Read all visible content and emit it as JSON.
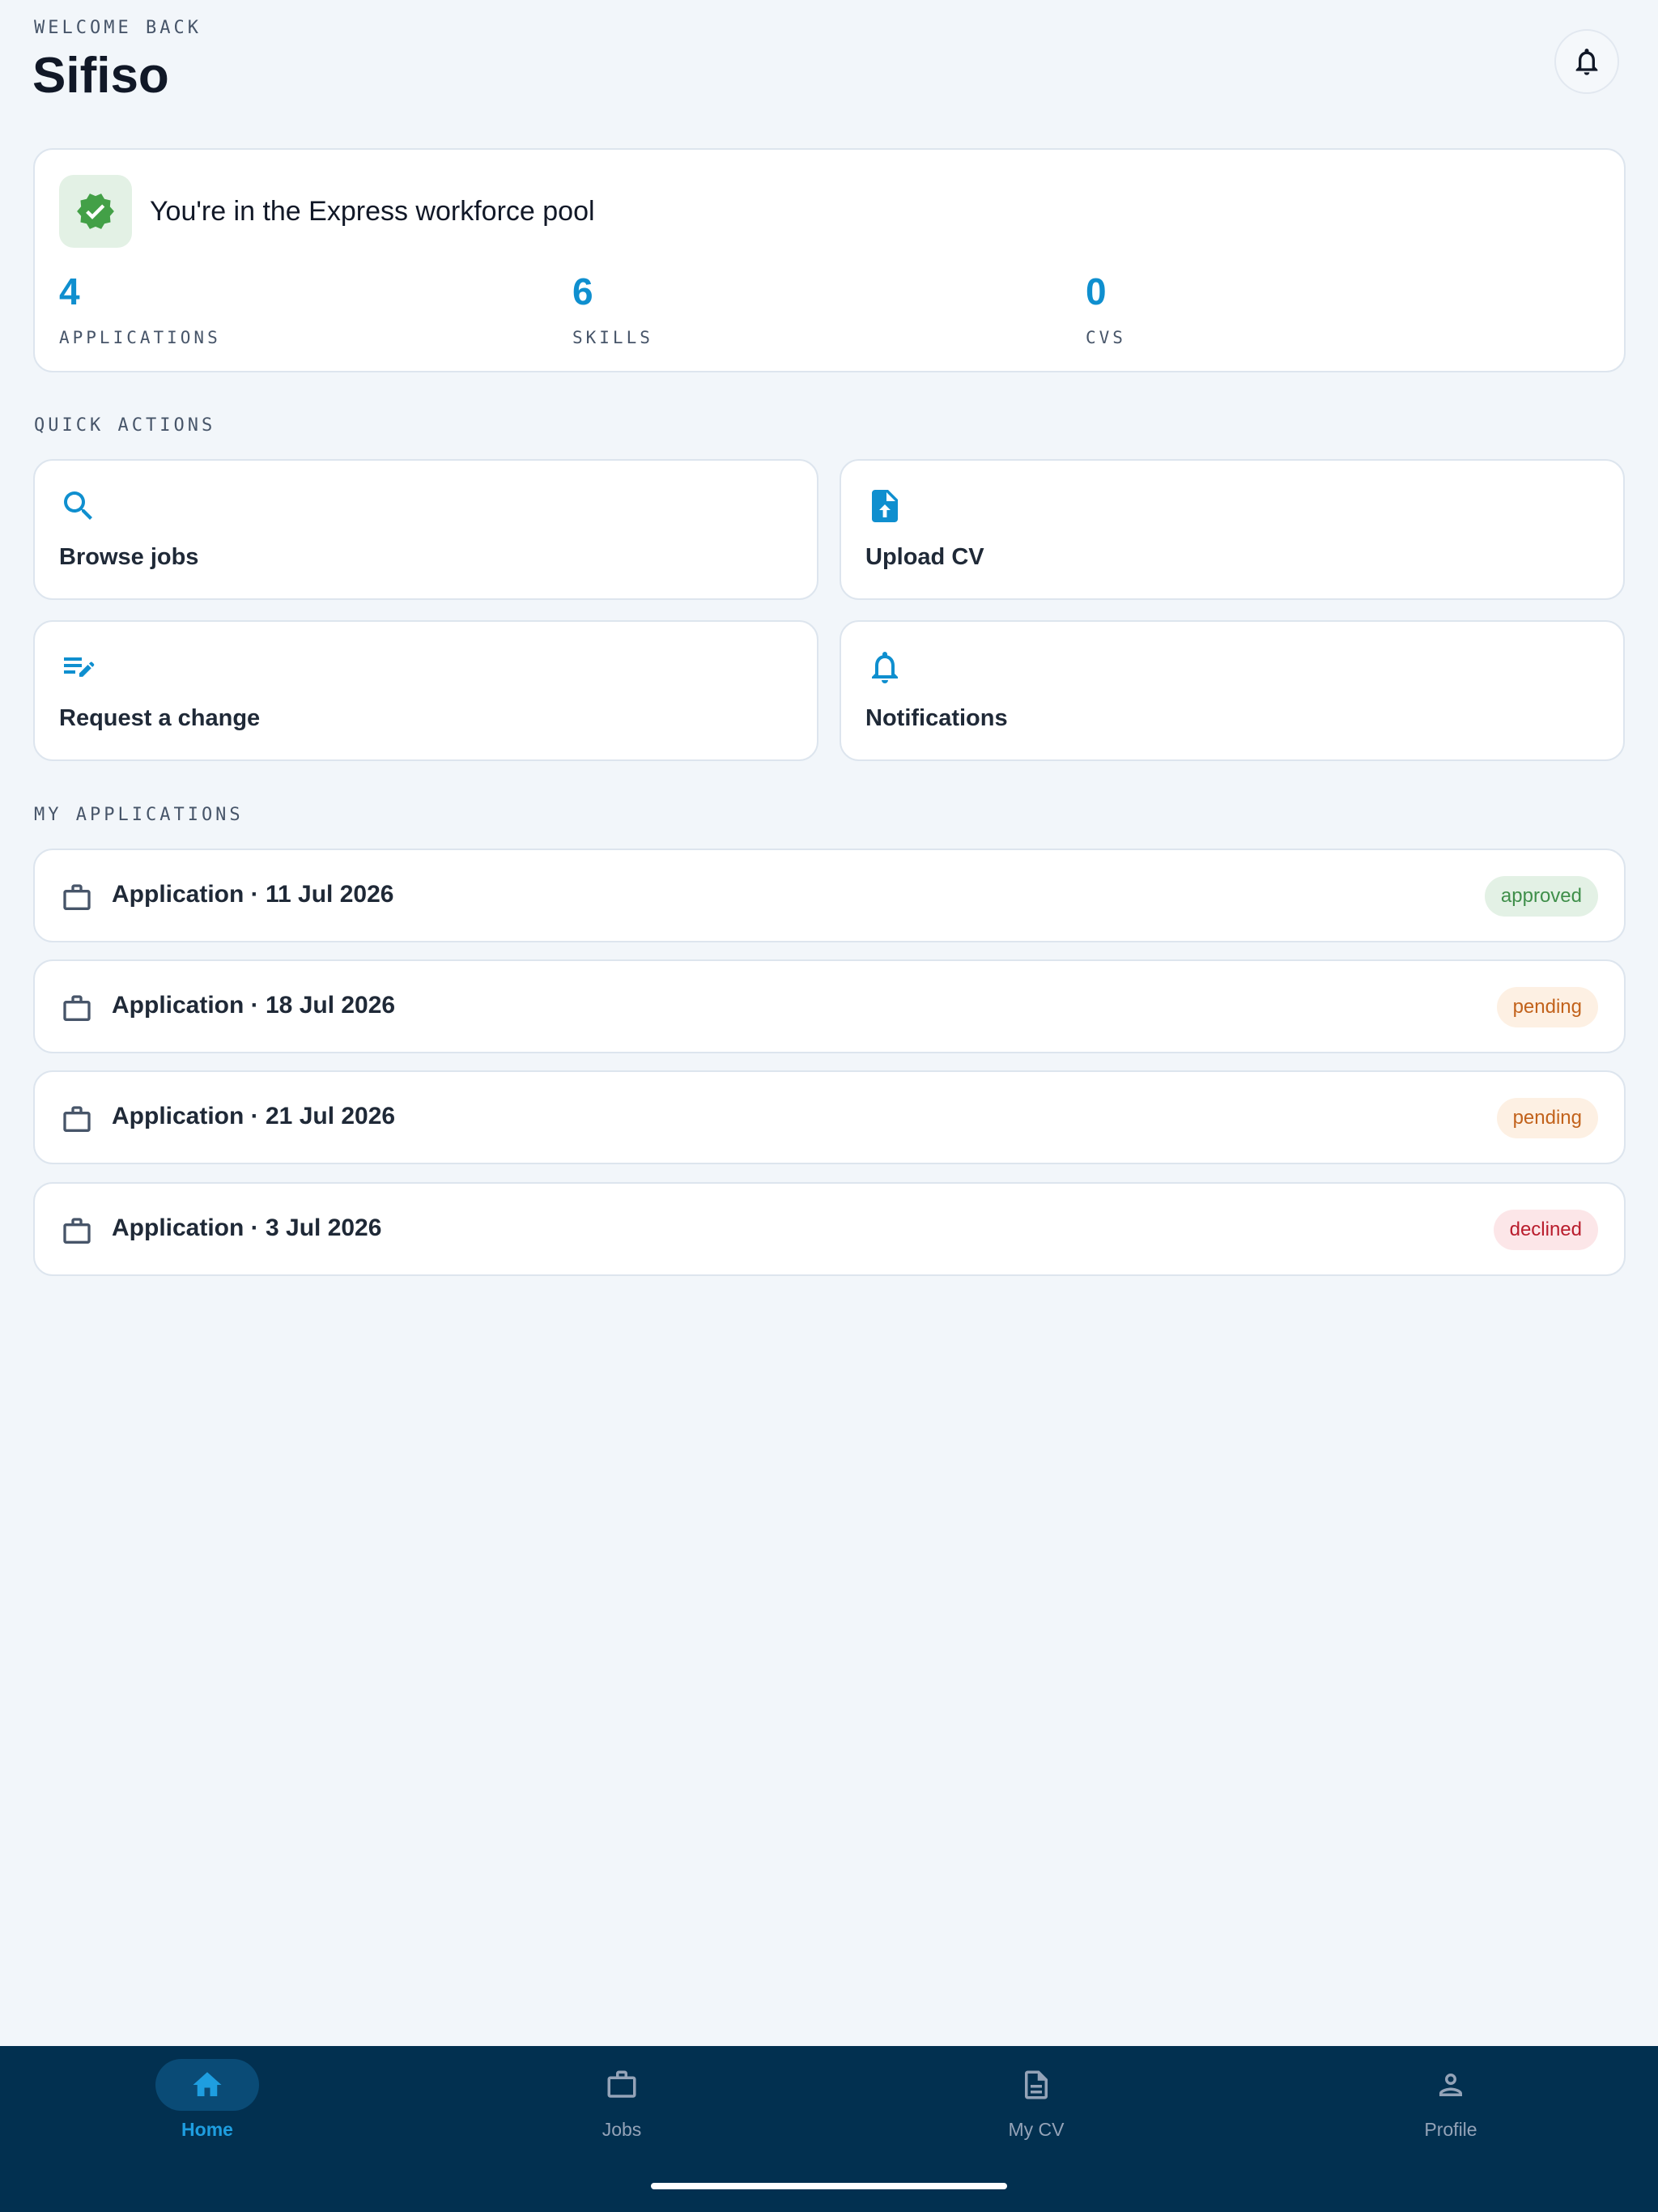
{
  "header": {
    "welcome": "WELCOME BACK",
    "user_name": "Sifiso",
    "bell_icon": "bell-icon"
  },
  "pool": {
    "title": "You're in the Express workforce pool",
    "badge_icon": "verified-badge-icon",
    "stats": [
      {
        "value": "4",
        "label": "APPLICATIONS"
      },
      {
        "value": "6",
        "label": "SKILLS"
      },
      {
        "value": "0",
        "label": "CVS"
      }
    ]
  },
  "quick_actions": {
    "heading": "QUICK ACTIONS",
    "items": [
      {
        "label": "Browse jobs",
        "icon": "search-icon"
      },
      {
        "label": "Upload CV",
        "icon": "upload-file-icon"
      },
      {
        "label": "Request a change",
        "icon": "edit-note-icon"
      },
      {
        "label": "Notifications",
        "icon": "bell-icon"
      }
    ]
  },
  "applications": {
    "heading": "MY APPLICATIONS",
    "items": [
      {
        "label": "Application · 11 Jul 2026",
        "status": "approved"
      },
      {
        "label": "Application · 18 Jul 2026",
        "status": "pending"
      },
      {
        "label": "Application · 21 Jul 2026",
        "status": "pending"
      },
      {
        "label": "Application · 3 Jul 2026",
        "status": "declined"
      }
    ]
  },
  "nav": {
    "items": [
      {
        "label": "Home",
        "icon": "home-icon",
        "active": true
      },
      {
        "label": "Jobs",
        "icon": "briefcase-icon",
        "active": false
      },
      {
        "label": "My CV",
        "icon": "document-icon",
        "active": false
      },
      {
        "label": "Profile",
        "icon": "person-icon",
        "active": false
      }
    ]
  },
  "colors": {
    "accent": "#0f8fcf",
    "nav_background": "#023050",
    "success": "#3f8f4a",
    "warning": "#c2621b",
    "danger": "#b91c2c"
  }
}
